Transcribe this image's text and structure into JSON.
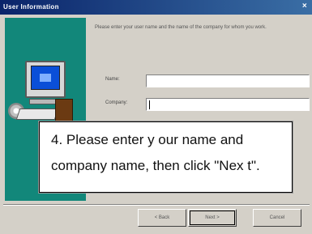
{
  "window": {
    "title": "User Information",
    "close_glyph": "×"
  },
  "illustration": {
    "icons": [
      "computer-monitor-icon",
      "cd-disc-icon",
      "keyboard-icon",
      "tower-icon"
    ]
  },
  "intro": {
    "text": "Please enter your user name and the name of the company for whom you work."
  },
  "form": {
    "name_label": "Name:",
    "company_label": "Company:",
    "name_value": "",
    "company_value": ""
  },
  "buttons": {
    "back": "< Back",
    "next": "Next >",
    "cancel": "Cancel"
  },
  "callout": {
    "line1": "4. Please enter y our name and",
    "line2": "company name, then click \"Nex t\"."
  },
  "colors": {
    "titlebar": "#0a246a",
    "illustration_bg": "#12877a",
    "dialog_bg": "#d4d0c8"
  }
}
